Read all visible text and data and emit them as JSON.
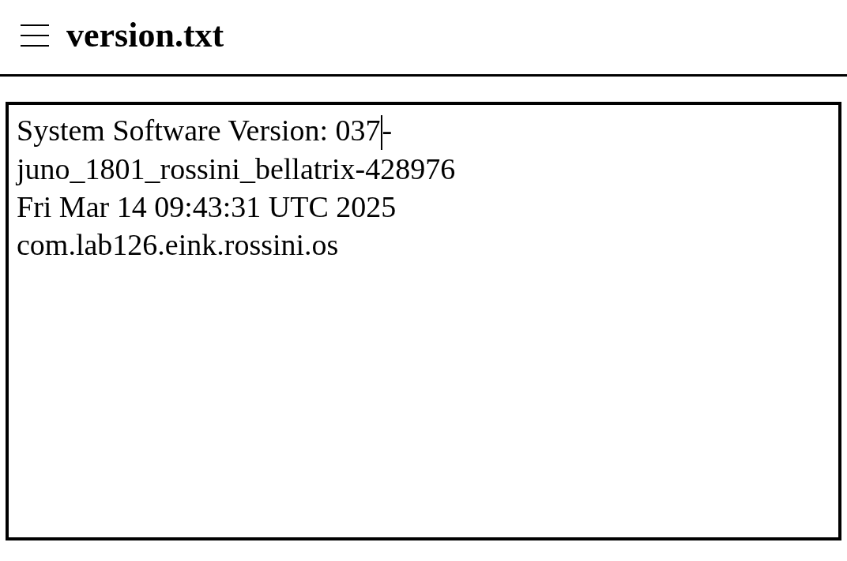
{
  "header": {
    "title": "version.txt"
  },
  "editor": {
    "lines": [
      {
        "segments": [
          "System Software Version: 037",
          "-"
        ],
        "cursor": true
      },
      {
        "segments": [
          "juno_1801_rossini_bellatrix-428976"
        ],
        "cursor": false
      },
      {
        "segments": [
          "Fri Mar 14 09:43:31 UTC 2025"
        ],
        "cursor": false
      },
      {
        "segments": [
          "com.lab126.eink.rossini.os"
        ],
        "cursor": false
      }
    ]
  }
}
